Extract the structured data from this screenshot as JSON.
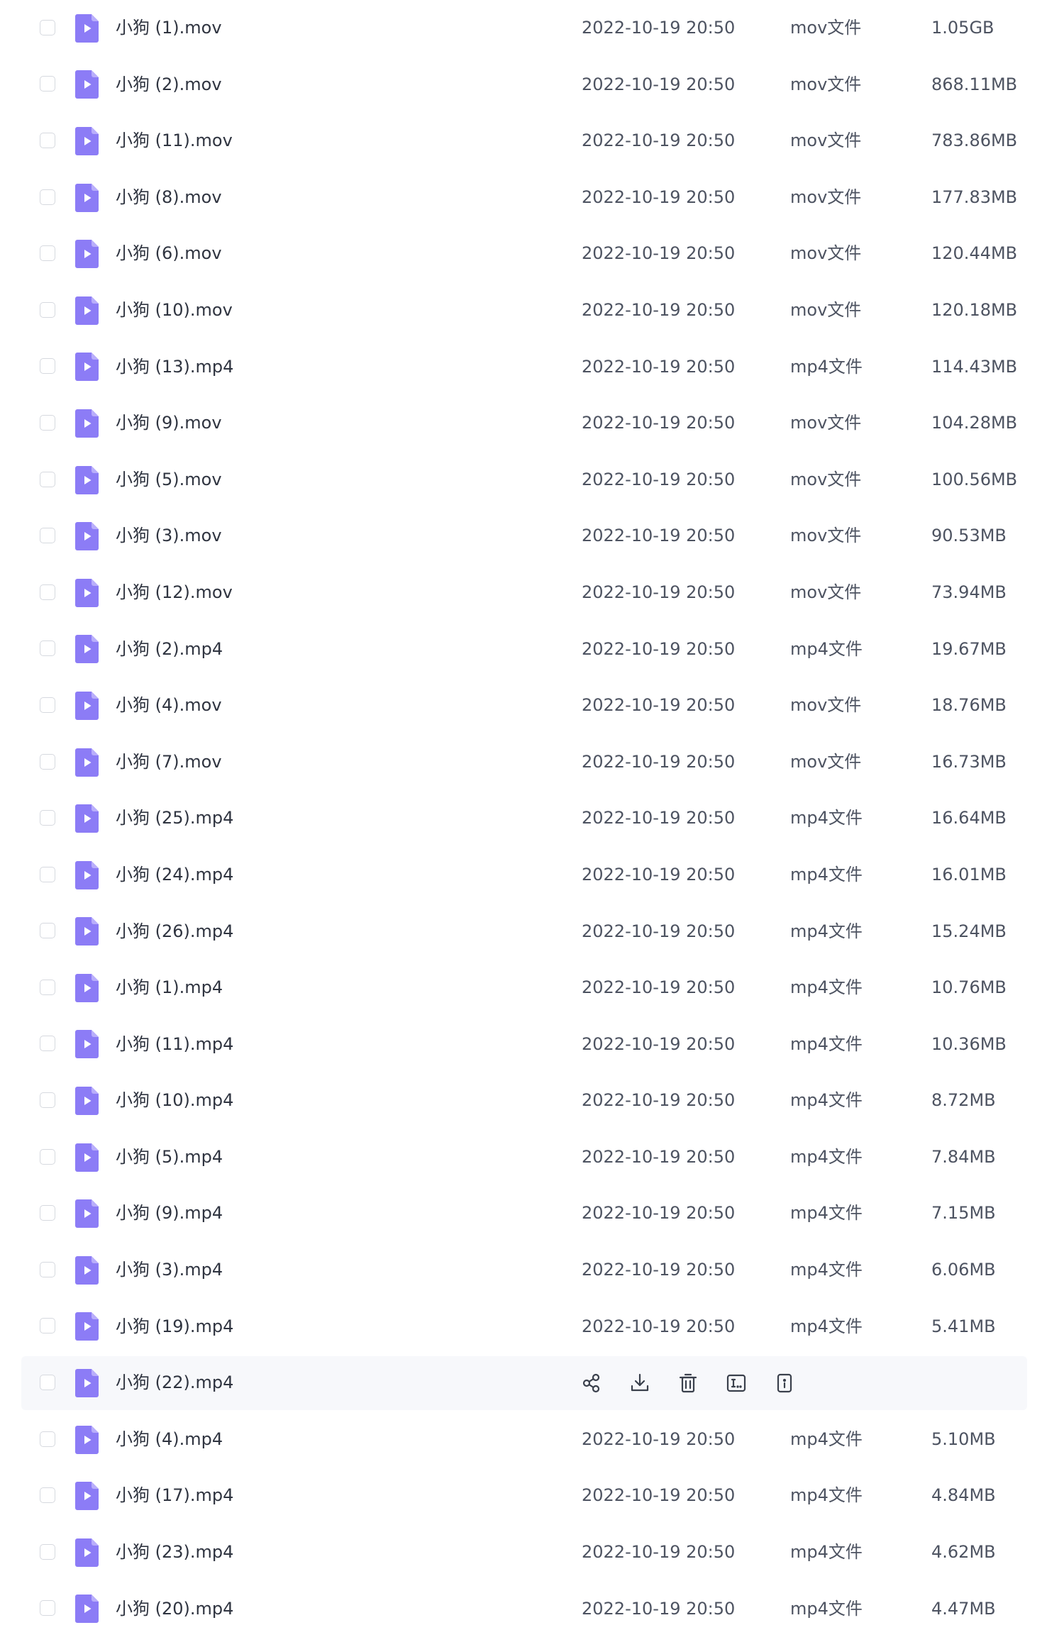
{
  "files": [
    {
      "name": "小狗 (1).mov",
      "modified": "2022-10-19 20:50",
      "type": "mov文件",
      "size": "1.05GB"
    },
    {
      "name": "小狗 (2).mov",
      "modified": "2022-10-19 20:50",
      "type": "mov文件",
      "size": "868.11MB"
    },
    {
      "name": "小狗 (11).mov",
      "modified": "2022-10-19 20:50",
      "type": "mov文件",
      "size": "783.86MB"
    },
    {
      "name": "小狗 (8).mov",
      "modified": "2022-10-19 20:50",
      "type": "mov文件",
      "size": "177.83MB"
    },
    {
      "name": "小狗 (6).mov",
      "modified": "2022-10-19 20:50",
      "type": "mov文件",
      "size": "120.44MB"
    },
    {
      "name": "小狗 (10).mov",
      "modified": "2022-10-19 20:50",
      "type": "mov文件",
      "size": "120.18MB"
    },
    {
      "name": "小狗 (13).mp4",
      "modified": "2022-10-19 20:50",
      "type": "mp4文件",
      "size": "114.43MB"
    },
    {
      "name": "小狗 (9).mov",
      "modified": "2022-10-19 20:50",
      "type": "mov文件",
      "size": "104.28MB"
    },
    {
      "name": "小狗 (5).mov",
      "modified": "2022-10-19 20:50",
      "type": "mov文件",
      "size": "100.56MB"
    },
    {
      "name": "小狗 (3).mov",
      "modified": "2022-10-19 20:50",
      "type": "mov文件",
      "size": "90.53MB"
    },
    {
      "name": "小狗 (12).mov",
      "modified": "2022-10-19 20:50",
      "type": "mov文件",
      "size": "73.94MB"
    },
    {
      "name": "小狗 (2).mp4",
      "modified": "2022-10-19 20:50",
      "type": "mp4文件",
      "size": "19.67MB"
    },
    {
      "name": "小狗 (4).mov",
      "modified": "2022-10-19 20:50",
      "type": "mov文件",
      "size": "18.76MB"
    },
    {
      "name": "小狗 (7).mov",
      "modified": "2022-10-19 20:50",
      "type": "mov文件",
      "size": "16.73MB"
    },
    {
      "name": "小狗 (25).mp4",
      "modified": "2022-10-19 20:50",
      "type": "mp4文件",
      "size": "16.64MB"
    },
    {
      "name": "小狗 (24).mp4",
      "modified": "2022-10-19 20:50",
      "type": "mp4文件",
      "size": "16.01MB"
    },
    {
      "name": "小狗 (26).mp4",
      "modified": "2022-10-19 20:50",
      "type": "mp4文件",
      "size": "15.24MB"
    },
    {
      "name": "小狗 (1).mp4",
      "modified": "2022-10-19 20:50",
      "type": "mp4文件",
      "size": "10.76MB"
    },
    {
      "name": "小狗 (11).mp4",
      "modified": "2022-10-19 20:50",
      "type": "mp4文件",
      "size": "10.36MB"
    },
    {
      "name": "小狗 (10).mp4",
      "modified": "2022-10-19 20:50",
      "type": "mp4文件",
      "size": "8.72MB"
    },
    {
      "name": "小狗 (5).mp4",
      "modified": "2022-10-19 20:50",
      "type": "mp4文件",
      "size": "7.84MB"
    },
    {
      "name": "小狗 (9).mp4",
      "modified": "2022-10-19 20:50",
      "type": "mp4文件",
      "size": "7.15MB"
    },
    {
      "name": "小狗 (3).mp4",
      "modified": "2022-10-19 20:50",
      "type": "mp4文件",
      "size": "6.06MB"
    },
    {
      "name": "小狗 (19).mp4",
      "modified": "2022-10-19 20:50",
      "type": "mp4文件",
      "size": "5.41MB"
    },
    {
      "name": "小狗 (22).mp4",
      "hovered": true,
      "actions": [
        "share-icon",
        "download-icon",
        "delete-icon",
        "rename-icon",
        "more-icon"
      ]
    },
    {
      "name": "小狗 (4).mp4",
      "modified": "2022-10-19 20:50",
      "type": "mp4文件",
      "size": "5.10MB"
    },
    {
      "name": "小狗 (17).mp4",
      "modified": "2022-10-19 20:50",
      "type": "mp4文件",
      "size": "4.84MB"
    },
    {
      "name": "小狗 (23).mp4",
      "modified": "2022-10-19 20:50",
      "type": "mp4文件",
      "size": "4.62MB"
    },
    {
      "name": "小狗 (20).mp4",
      "modified": "2022-10-19 20:50",
      "type": "mp4文件",
      "size": "4.47MB"
    }
  ],
  "file_icon": "video-file-icon",
  "colors": {
    "file_icon": "#8c7cf6",
    "hover_row": "#f7f8fb",
    "checkbox_border": "#d6d9df",
    "text_primary": "#2f3440",
    "text_secondary": "#4d5361",
    "action_icon": "#3a404c"
  }
}
